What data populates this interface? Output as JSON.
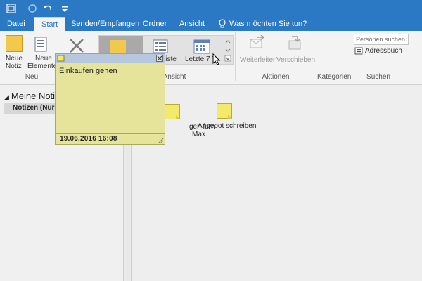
{
  "ribbon_tabs": [
    "Datei",
    "Start",
    "Senden/Empfangen",
    "Ordner",
    "Ansicht"
  ],
  "tell_me": "Was möchten Sie tun?",
  "ribbon": {
    "new_note": [
      "Neue",
      "Notiz"
    ],
    "new_items": [
      "Neue",
      "Elemente"
    ],
    "view_list": "liste",
    "view_last7": "Letzte 7 T",
    "forward": "Weiterleiten",
    "move": "Verschieben",
    "search_placeholder": "Personen suchen",
    "address_book": "Adressbuch",
    "groups": {
      "new": "Neu",
      "view": "Ansicht",
      "actions": "Aktionen",
      "categories": "Kategorien",
      "search": "Suchen"
    }
  },
  "nav": {
    "title": "Meine Notiz",
    "item": "Notizen (Nur d"
  },
  "notes": [
    {
      "label_lines": [
        "gen fürn",
        "Max"
      ]
    },
    {
      "label_lines": [
        "Angebot schreiben"
      ]
    }
  ],
  "sticky": {
    "text": "Einkaufen gehen",
    "date": "19.06.2016 16:08"
  },
  "colors": {
    "accent": "#2b78c5",
    "note_yellow": "#f3ea6c",
    "sticky_bg": "#e6e49b"
  }
}
